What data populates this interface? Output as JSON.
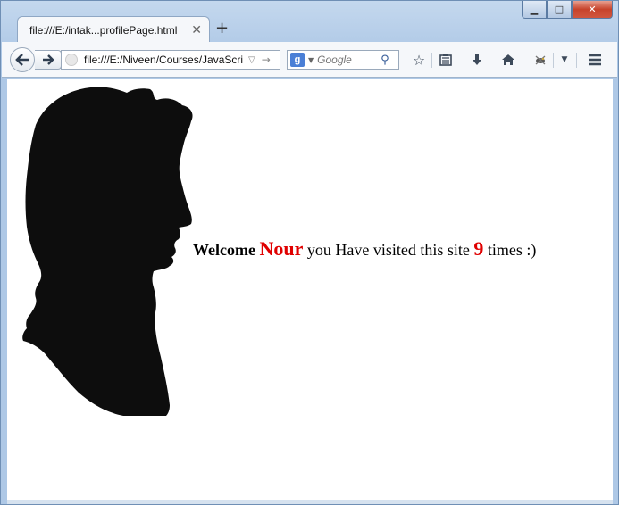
{
  "browser": {
    "tab_title": "file:///E:/intak...profilePage.html",
    "url": "file:///E:/Niveen/Courses/JavaScri",
    "search_engine_letter": "g",
    "search_placeholder": "Google",
    "accent_color": "#4a7fd6"
  },
  "toolbar_icons": [
    "back-icon",
    "forward-icon",
    "bookmark-star-icon",
    "reading-list-icon",
    "downloads-icon",
    "home-icon",
    "addon-icon",
    "menu-dropdown-icon",
    "hamburger-menu-icon"
  ],
  "page": {
    "welcome": "Welcome",
    "name": "Nour",
    "visit_text": "you Have visited this site",
    "visit_count": "9",
    "suffix": "times :)",
    "highlight_color": "#e00000"
  }
}
